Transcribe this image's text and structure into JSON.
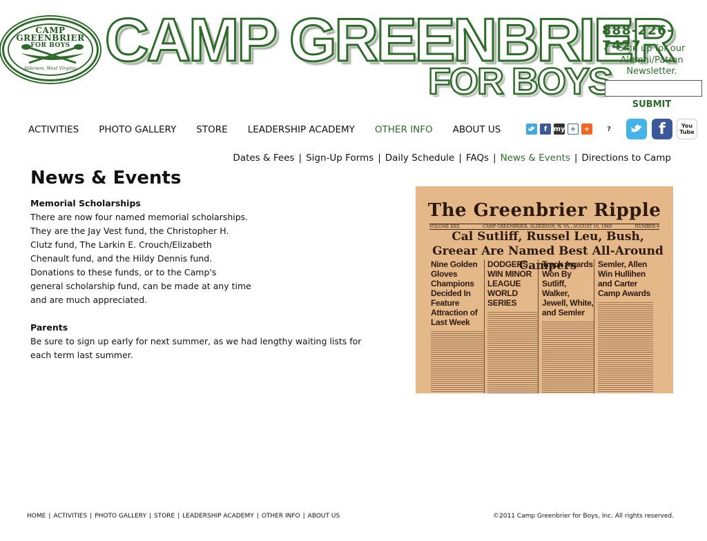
{
  "logo": {
    "line1": "CAMP GREENBRIER",
    "line2": "FOR BOYS",
    "location": "Alderson, West Virginia"
  },
  "header": {
    "title": "CAMP GREENBRIER",
    "subtitle": "FOR BOYS",
    "phone": "888-226-7427",
    "newsletter_prompt": "Sign up for our Alumni/Patron Newsletter.",
    "newsletter_value": "",
    "submit_label": "SUBMIT"
  },
  "nav": {
    "items": [
      {
        "label": "ACTIVITIES"
      },
      {
        "label": "PHOTO GALLERY"
      },
      {
        "label": "STORE"
      },
      {
        "label": "LEADERSHIP ACADEMY"
      },
      {
        "label": "OTHER INFO"
      },
      {
        "label": "ABOUT US"
      }
    ],
    "active": "OTHER INFO"
  },
  "share": {
    "icons": [
      "twitter-small-icon",
      "facebook-small-icon",
      "myspace-icon",
      "add-icon",
      "addthis-icon",
      "help-icon"
    ],
    "myspace_text": "my",
    "help_text": "?",
    "social": [
      "twitter-icon",
      "facebook-icon",
      "youtube-icon"
    ],
    "youtube_text": "You Tube"
  },
  "subnav": {
    "items": [
      {
        "label": "Dates & Fees"
      },
      {
        "label": "Sign-Up Forms"
      },
      {
        "label": "Daily Schedule"
      },
      {
        "label": "FAQs"
      },
      {
        "label": "News & Events"
      },
      {
        "label": "Directions to Camp"
      }
    ],
    "active": "News & Events",
    "separator": "|"
  },
  "main": {
    "page_title": "News & Events",
    "sections": [
      {
        "heading": "Memorial Scholarships",
        "body": "There are now four named memorial scholarships. They are the Jay Vest fund, the Christopher H. Clutz fund, The Larkin E. Crouch/Elizabeth Chenault fund, and the Hildy Dennis fund. Donations to these funds, or to the Camp's general scholarship fund, can be made at any time and are much appreciated."
      },
      {
        "heading": "Parents",
        "body": "Be sure to sign up early for next summer, as we had lengthy waiting lists for each term last summer."
      }
    ]
  },
  "newspaper": {
    "masthead": "The Greenbrier Ripple",
    "volume": "VOLUME XXII",
    "dateline": "CAMP GREENBRIER, ALDERSON, W. VA., AUGUST 16, 1949",
    "number": "NUMBER 6",
    "headline": "Cal Sutliff, Russel Leu, Bush, Greear Are Named Best All-Around Campers",
    "columns": [
      "Nine Golden Gloves Champions Decided In Feature Attraction of Last Week",
      "DODGERS WIN MINOR LEAGUE WORLD SERIES",
      "Track Awards Won By Sutliff, Walker, Jewell, White, and Semler",
      "Semler, Allen Win Hullihen and Carter Camp Awards"
    ]
  },
  "footer": {
    "links": [
      {
        "label": "HOME"
      },
      {
        "label": "ACTIVITIES"
      },
      {
        "label": "PHOTO GALLERY"
      },
      {
        "label": "STORE"
      },
      {
        "label": "LEADERSHIP ACADEMY"
      },
      {
        "label": "OTHER INFO"
      },
      {
        "label": "ABOUT US"
      }
    ],
    "separator": "|",
    "copyright": "©2011 Camp Greenbrier for Boys, Inc. All rights reserved."
  },
  "colors": {
    "brand_green": "#2e6b2a",
    "text": "#111111",
    "paper": "#e5b88a"
  }
}
